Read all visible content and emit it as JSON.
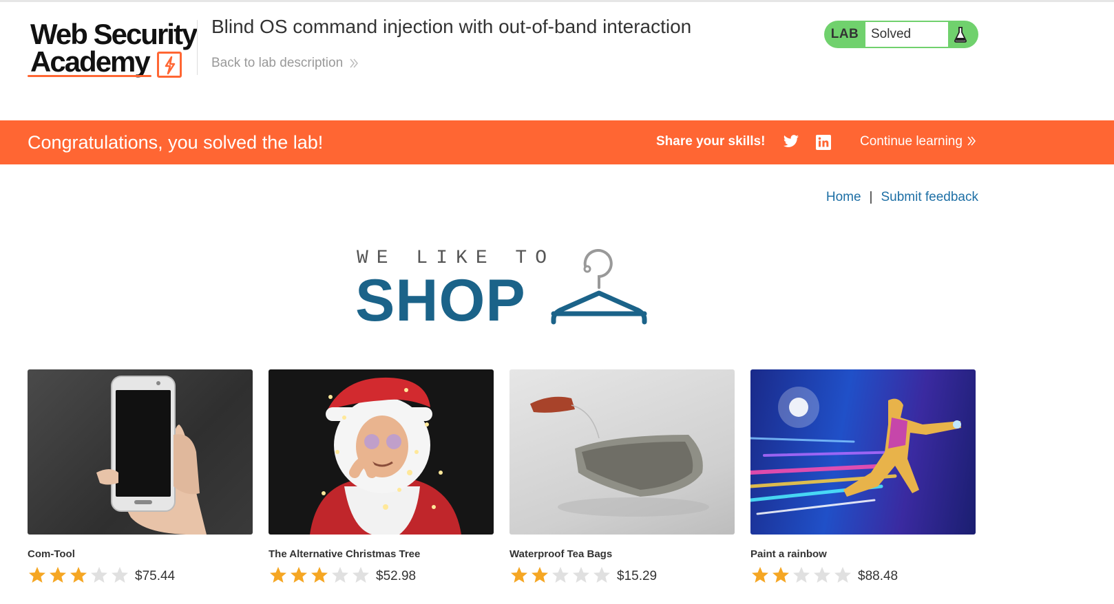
{
  "header": {
    "logo_line1": "Web Security",
    "logo_line2": "Academy",
    "lab_title": "Blind OS command injection with out-of-band interaction",
    "back_link": "Back to lab description",
    "lab_tag": "LAB",
    "lab_status": "Solved"
  },
  "banner": {
    "message": "Congratulations, you solved the lab!",
    "share_label": "Share your skills!",
    "continue_label": "Continue learning"
  },
  "nav": {
    "home": "Home",
    "separator": "|",
    "feedback": "Submit feedback"
  },
  "shop_logo": {
    "tagline": "WE LIKE TO",
    "word": "SHOP"
  },
  "products": [
    {
      "name": "Com-Tool",
      "rating": 3,
      "price": "$75.44"
    },
    {
      "name": "The Alternative Christmas Tree",
      "rating": 3,
      "price": "$52.98"
    },
    {
      "name": "Waterproof Tea Bags",
      "rating": 2,
      "price": "$15.29"
    },
    {
      "name": "Paint a rainbow",
      "rating": 2,
      "price": "$88.48"
    }
  ],
  "colors": {
    "orange": "#ff6633",
    "lab_green": "#70d16d",
    "shop_blue": "#1b6389",
    "link_blue": "#1d6fa5",
    "star_filled": "#f5a623",
    "star_empty": "#e0e0e0"
  }
}
